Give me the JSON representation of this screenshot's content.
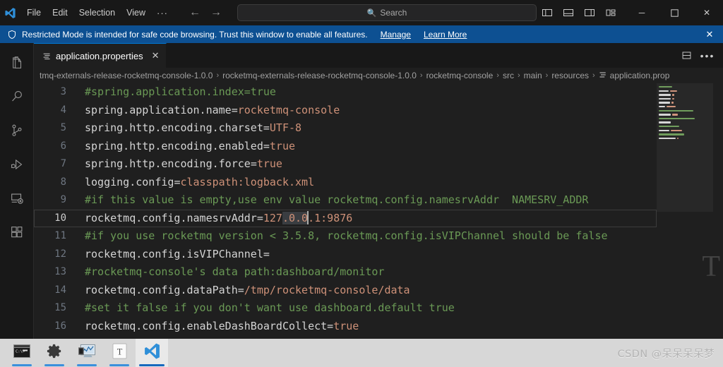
{
  "window": {
    "menus": [
      "File",
      "Edit",
      "Selection",
      "View",
      "···"
    ],
    "nav_back": "←",
    "nav_forward": "→",
    "search_placeholder": "Search",
    "layout_buttons": [
      "toggle-primary-sidebar",
      "toggle-panel",
      "toggle-secondary-sidebar",
      "customize-layout"
    ],
    "minimize": "─",
    "maximize": "☐",
    "close": "✕"
  },
  "banner": {
    "text": "Restricted Mode is intended for safe code browsing. Trust this window to enable all features.",
    "manage_label": "Manage",
    "learn_more_label": "Learn More",
    "close_label": "✕",
    "background": "#0d5092"
  },
  "activitybar": {
    "items": [
      {
        "name": "explorer",
        "icon": "files-icon"
      },
      {
        "name": "search",
        "icon": "search-icon"
      },
      {
        "name": "source-control",
        "icon": "source-control-icon"
      },
      {
        "name": "run-and-debug",
        "icon": "debug-icon"
      },
      {
        "name": "remote-explorer",
        "icon": "remote-icon"
      },
      {
        "name": "extensions",
        "icon": "extensions-icon"
      }
    ]
  },
  "tab": {
    "label": "application.properties",
    "close_label": "✕",
    "active_border": "#0078d4"
  },
  "editor_actions": {
    "split_editor": "split-editor-icon",
    "more_actions": "•••"
  },
  "breadcrumbs": {
    "separator": "›",
    "items": [
      "tmq-externals-release-rocketmq-console-1.0.0",
      "rocketmq-externals-release-rocketmq-console-1.0.0",
      "rocketmq-console",
      "src",
      "main",
      "resources",
      "application.prop"
    ]
  },
  "editor": {
    "first_line_number": 3,
    "current_line": 10,
    "selection_text": ".0.0",
    "lines": [
      {
        "num": 3,
        "type": "comment",
        "text": "#spring.application.index=true"
      },
      {
        "num": 4,
        "type": "prop",
        "key": "spring.application.name",
        "value": "rocketmq-console"
      },
      {
        "num": 5,
        "type": "prop",
        "key": "spring.http.encoding.charset",
        "value": "UTF-8"
      },
      {
        "num": 6,
        "type": "prop",
        "key": "spring.http.encoding.enabled",
        "value": "true"
      },
      {
        "num": 7,
        "type": "prop",
        "key": "spring.http.encoding.force",
        "value": "true"
      },
      {
        "num": 8,
        "type": "prop",
        "key": "logging.config",
        "value": "classpath:logback.xml"
      },
      {
        "num": 9,
        "type": "comment",
        "text": "#if this value is empty,use env value rocketmq.config.namesrvAddr  NAMESRV_ADDR"
      },
      {
        "num": 10,
        "type": "prop-selected",
        "key": "rocketmq.config.namesrvAddr",
        "value_pre": "127",
        "value_sel": ".0.0",
        "value_post": ".1:9876"
      },
      {
        "num": 11,
        "type": "comment",
        "text": "#if you use rocketmq version < 3.5.8, rocketmq.config.isVIPChannel should be false"
      },
      {
        "num": 12,
        "type": "prop",
        "key": "rocketmq.config.isVIPChannel",
        "value": ""
      },
      {
        "num": 13,
        "type": "comment",
        "text": "#rocketmq-console's data path:dashboard/monitor"
      },
      {
        "num": 14,
        "type": "prop",
        "key": "rocketmq.config.dataPath",
        "value": "/tmp/rocketmq-console/data"
      },
      {
        "num": 15,
        "type": "comment",
        "text": "#set it false if you don't want use dashboard.default true"
      },
      {
        "num": 16,
        "type": "prop",
        "key": "rocketmq.config.enableDashBoardCollect",
        "value": "true"
      }
    ],
    "colors": {
      "comment": "#6a9955",
      "value": "#ce9178",
      "key": "#d4d4d4",
      "line_number": "#6e7681",
      "background": "#1f1f1f",
      "selection": "#3a3d41"
    }
  },
  "overlay": {
    "side_letter": "T"
  },
  "taskbar": {
    "items": [
      {
        "name": "command-prompt",
        "icon": "terminal-icon",
        "active": false
      },
      {
        "name": "settings",
        "icon": "gear-icon",
        "active": false
      },
      {
        "name": "task-manager",
        "icon": "monitor-chart-icon",
        "active": false
      },
      {
        "name": "text-app",
        "icon": "letter-t-icon",
        "active": false
      },
      {
        "name": "visual-studio-code",
        "icon": "vscode-icon",
        "active": true
      }
    ],
    "watermark": "CSDN @呆呆呆呆梦"
  }
}
